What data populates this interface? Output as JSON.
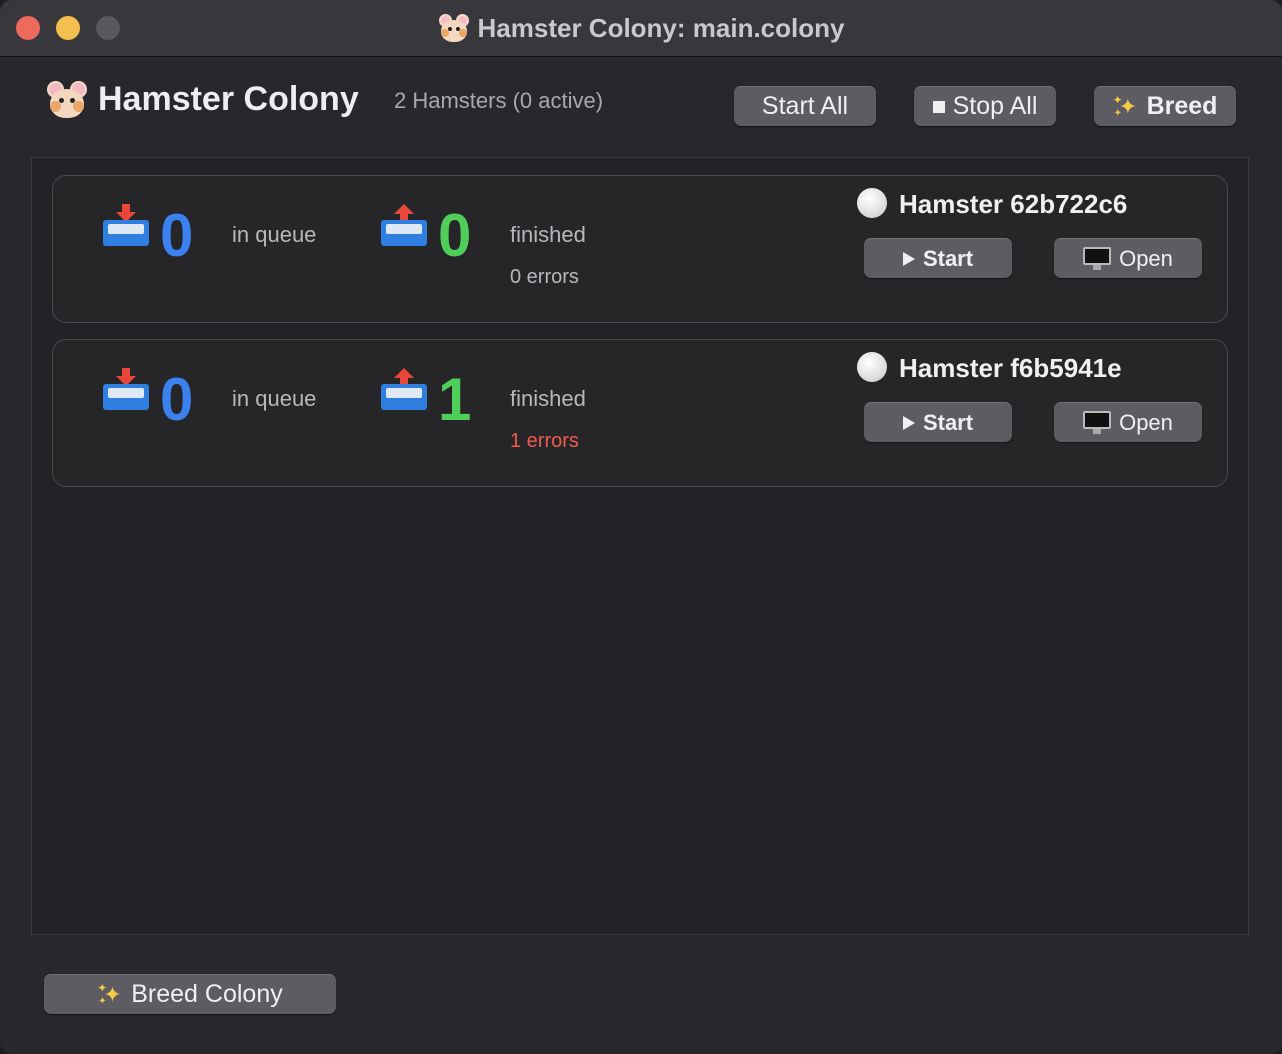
{
  "window": {
    "title": "Hamster Colony: main.colony"
  },
  "header": {
    "app_title": "Hamster Colony",
    "hamster_count": "2 Hamsters (0 active)",
    "start_all_label": "Start All",
    "stop_all_label": "Stop All",
    "breed_label": "Breed"
  },
  "hamsters": [
    {
      "name": "Hamster 62b722c6",
      "in_queue": "0",
      "in_queue_label": "in queue",
      "finished": "0",
      "finished_label": "finished",
      "errors": "0 errors",
      "start_label": "Start",
      "open_label": "Open"
    },
    {
      "name": "Hamster f6b5941e",
      "in_queue": "0",
      "in_queue_label": "in queue",
      "finished": "1",
      "finished_label": "finished",
      "errors": "1 errors",
      "start_label": "Start",
      "open_label": "Open"
    }
  ],
  "footer": {
    "breed_colony_label": "Breed Colony"
  },
  "colors": {
    "queue_count": "#3b82f0",
    "finished_count": "#4fcf5a",
    "error_text": "#ef5a4c",
    "window_bg": "#28282c"
  }
}
